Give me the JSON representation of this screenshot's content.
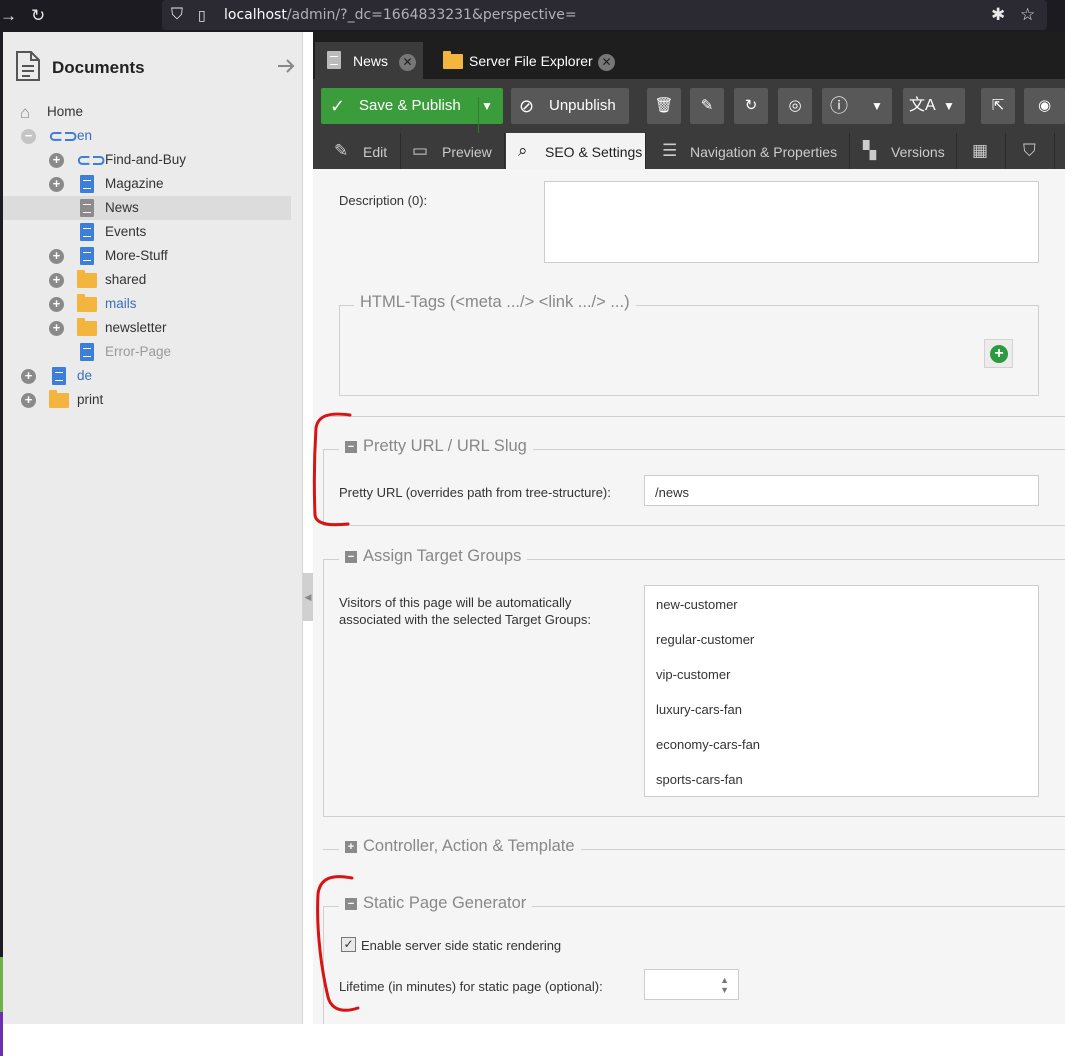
{
  "browser": {
    "url_host": "localhost",
    "url_rest": "/admin/?_dc=1664833231&perspective="
  },
  "sidebar": {
    "title": "Documents",
    "items": [
      {
        "label": "Home"
      },
      {
        "label": "en"
      },
      {
        "label": "Find-and-Buy"
      },
      {
        "label": "Magazine"
      },
      {
        "label": "News"
      },
      {
        "label": "Events"
      },
      {
        "label": "More-Stuff"
      },
      {
        "label": "shared"
      },
      {
        "label": "mails"
      },
      {
        "label": "newsletter"
      },
      {
        "label": "Error-Page"
      },
      {
        "label": "de"
      },
      {
        "label": "print"
      }
    ]
  },
  "tabs": [
    {
      "label": "News"
    },
    {
      "label": "Server File Explorer"
    }
  ],
  "toolbar": {
    "save_publish": "Save & Publish",
    "unpublish": "Unpublish"
  },
  "subtabs": [
    {
      "label": "Edit"
    },
    {
      "label": "Preview"
    },
    {
      "label": "SEO & Settings"
    },
    {
      "label": "Navigation & Properties"
    },
    {
      "label": "Versions"
    }
  ],
  "form": {
    "description_label": "Description (0):",
    "html_tags_legend": "HTML-Tags (<meta .../> <link .../> ...)",
    "pretty_url_legend": "Pretty URL / URL Slug",
    "pretty_url_label": "Pretty URL (overrides path from tree-structure):",
    "pretty_url_value": "/news",
    "target_groups_legend": "Assign Target Groups",
    "target_groups_label_1": "Visitors of this page will be automatically",
    "target_groups_label_2": "associated with the selected Target Groups:",
    "target_groups": [
      "new-customer",
      "regular-customer",
      "vip-customer",
      "luxury-cars-fan",
      "economy-cars-fan",
      "sports-cars-fan"
    ],
    "controller_legend": "Controller, Action & Template",
    "static_legend": "Static Page Generator",
    "static_enable_label": "Enable server side static rendering",
    "static_lifetime_label": "Lifetime (in minutes) for static page (optional):"
  }
}
